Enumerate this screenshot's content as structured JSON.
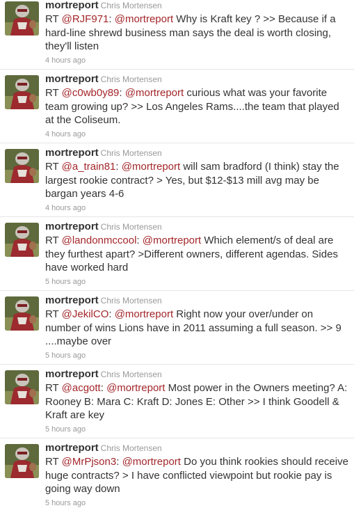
{
  "tweets": [
    {
      "screen_name": "mortreport",
      "full_name": "Chris Mortensen",
      "segments": [
        {
          "t": "RT "
        },
        {
          "t": "@RJF971",
          "link": true
        },
        {
          "t": ": "
        },
        {
          "t": "@mortreport",
          "link": true
        },
        {
          "t": " Why is Kraft key ? >> Because if a hard-line shrewd business man says the deal is worth closing, they'll listen"
        }
      ],
      "time": "4 hours ago"
    },
    {
      "screen_name": "mortreport",
      "full_name": "Chris Mortensen",
      "segments": [
        {
          "t": "RT "
        },
        {
          "t": "@c0wb0y89",
          "link": true
        },
        {
          "t": ": "
        },
        {
          "t": "@mortreport",
          "link": true
        },
        {
          "t": " curious what was your favorite team growing up? >> Los Angeles Rams....the team that played at the Coliseum."
        }
      ],
      "time": "4 hours ago"
    },
    {
      "screen_name": "mortreport",
      "full_name": "Chris Mortensen",
      "segments": [
        {
          "t": "RT "
        },
        {
          "t": "@a_train81",
          "link": true
        },
        {
          "t": ": "
        },
        {
          "t": "@mortreport",
          "link": true
        },
        {
          "t": " will sam bradford (I think) stay the largest rookie contract? > Yes, but $12-$13 mill avg may be bargan years 4-6"
        }
      ],
      "time": "4 hours ago"
    },
    {
      "screen_name": "mortreport",
      "full_name": "Chris Mortensen",
      "segments": [
        {
          "t": "RT "
        },
        {
          "t": "@landonmccool",
          "link": true
        },
        {
          "t": ": "
        },
        {
          "t": "@mortreport",
          "link": true
        },
        {
          "t": " Which element/s of deal are they furthest apart? >Different owners, different agendas. Sides have worked hard"
        }
      ],
      "time": "5 hours ago"
    },
    {
      "screen_name": "mortreport",
      "full_name": "Chris Mortensen",
      "segments": [
        {
          "t": "RT "
        },
        {
          "t": "@JekilCO",
          "link": true
        },
        {
          "t": ": "
        },
        {
          "t": "@mortreport",
          "link": true
        },
        {
          "t": " Right now your over/under on number of wins Lions have in 2011 assuming a full season. >> 9 ....maybe over"
        }
      ],
      "time": "5 hours ago"
    },
    {
      "screen_name": "mortreport",
      "full_name": "Chris Mortensen",
      "segments": [
        {
          "t": "RT "
        },
        {
          "t": "@acgott",
          "link": true
        },
        {
          "t": ": "
        },
        {
          "t": "@mortreport",
          "link": true
        },
        {
          "t": " Most power in the Owners meeting? A: Rooney B: Mara C: Kraft D: Jones E: Other >> I think Goodell & Kraft are key"
        }
      ],
      "time": "5 hours ago"
    },
    {
      "screen_name": "mortreport",
      "full_name": "Chris Mortensen",
      "segments": [
        {
          "t": "RT "
        },
        {
          "t": "@MrPjson3",
          "link": true
        },
        {
          "t": ": "
        },
        {
          "t": "@mortreport",
          "link": true
        },
        {
          "t": " Do you think rookies should receive huge contracts? > I have conflicted viewpoint but rookie pay is going way down"
        }
      ],
      "time": "5 hours ago"
    }
  ],
  "colors": {
    "link": "#a3262a",
    "text": "#333333",
    "meta": "#999999",
    "divider": "#e6e6e6"
  },
  "avatar_icon": "user-photo-icon"
}
